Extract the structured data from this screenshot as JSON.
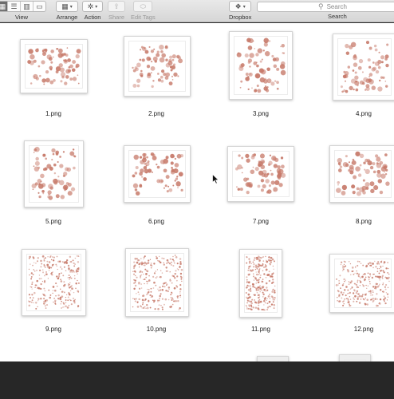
{
  "toolbar": {
    "view_label": "View",
    "arrange_label": "Arrange",
    "action_label": "Action",
    "share_label": "Share",
    "edit_tags_label": "Edit Tags",
    "dropbox_label": "Dropbox",
    "search_label": "Search",
    "search_placeholder": "Search"
  },
  "files": [
    {
      "name": "1.png"
    },
    {
      "name": "2.png"
    },
    {
      "name": "3.png"
    },
    {
      "name": "4.png"
    },
    {
      "name": "5.png"
    },
    {
      "name": "6.png"
    },
    {
      "name": "7.png"
    },
    {
      "name": "8.png"
    },
    {
      "name": "9.png"
    },
    {
      "name": "10.png"
    },
    {
      "name": "11.png"
    },
    {
      "name": "12.png"
    }
  ],
  "colors": {
    "accent_dot": "#c77a6a"
  }
}
